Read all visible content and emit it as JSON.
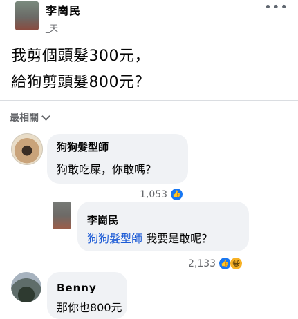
{
  "post": {
    "author": "李崗民",
    "time": "_天",
    "lines": [
      "我剪個頭髮300元，",
      "給狗剪頭髮800元？"
    ],
    "more_icon": "ellipsis-icon"
  },
  "sort_label": "最相關",
  "comments": [
    {
      "name": "狗狗髮型師",
      "text": "狗敢吃屎，你敢嗎？",
      "reactions": "1,053",
      "reaction_icons": [
        "like-icon"
      ]
    },
    {
      "name": "李崗民",
      "mention": "狗狗髮型師",
      "text": " 我要是敢呢？",
      "reactions": "2,133",
      "reaction_icons": [
        "like-icon",
        "haha-icon"
      ]
    },
    {
      "name": "Benny",
      "text": "那你也800元"
    }
  ],
  "colors": {
    "mention": "#1c5bd6",
    "like": "#1877f2",
    "haha": "#f7b125",
    "bubble": "#f0f2f5"
  }
}
